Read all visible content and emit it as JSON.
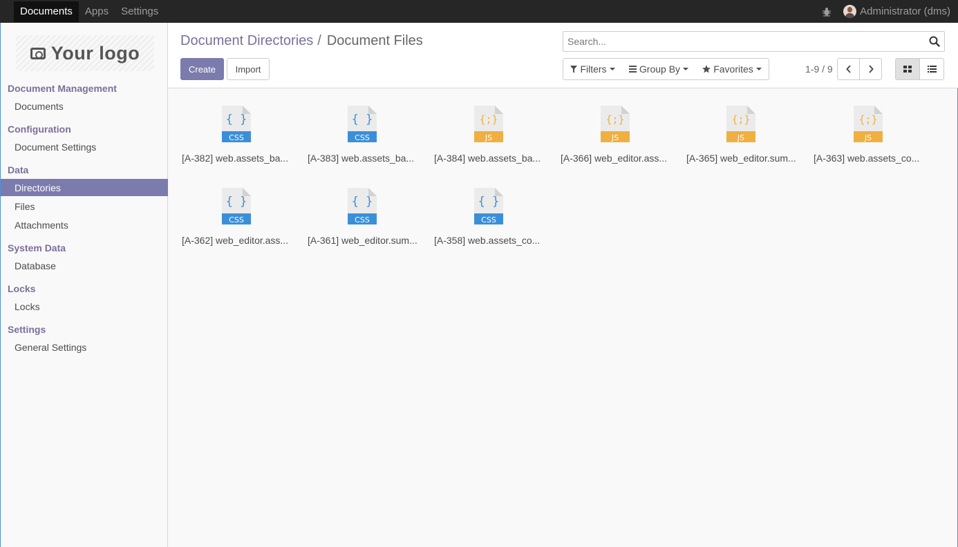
{
  "topbar": {
    "app_name": "Documents",
    "nav": [
      "Apps",
      "Settings"
    ],
    "user_name": "Administrator (dms)",
    "debug_icon": "bug-icon"
  },
  "sidebar": {
    "logo_text": "Your logo",
    "sections": [
      {
        "title": "Document Management",
        "items": [
          {
            "label": "Documents"
          }
        ]
      },
      {
        "title": "Configuration",
        "items": [
          {
            "label": "Document Settings"
          }
        ]
      },
      {
        "title": "Data",
        "items": [
          {
            "label": "Directories",
            "active": true
          },
          {
            "label": "Files"
          },
          {
            "label": "Attachments"
          }
        ]
      },
      {
        "title": "System Data",
        "items": [
          {
            "label": "Database"
          }
        ]
      },
      {
        "title": "Locks",
        "items": [
          {
            "label": "Locks"
          }
        ]
      },
      {
        "title": "Settings",
        "items": [
          {
            "label": "General Settings"
          }
        ]
      }
    ]
  },
  "control": {
    "breadcrumb_parent": "Document Directories",
    "breadcrumb_sep": "/",
    "breadcrumb_current": "Document Files",
    "create_label": "Create",
    "import_label": "Import",
    "search_placeholder": "Search...",
    "filters_label": "Filters",
    "groupby_label": "Group By",
    "favorites_label": "Favorites",
    "pager": "1-9 / 9",
    "active_view": "kanban"
  },
  "files": [
    {
      "label": "[A-382] web.assets_ba...",
      "type": "CSS"
    },
    {
      "label": "[A-383] web.assets_ba...",
      "type": "CSS"
    },
    {
      "label": "[A-384] web.assets_ba...",
      "type": "JS"
    },
    {
      "label": "[A-366] web_editor.ass...",
      "type": "JS"
    },
    {
      "label": "[A-365] web_editor.sum...",
      "type": "JS"
    },
    {
      "label": "[A-363] web.assets_co...",
      "type": "JS"
    },
    {
      "label": "[A-362] web_editor.ass...",
      "type": "CSS"
    },
    {
      "label": "[A-361] web_editor.sum...",
      "type": "CSS"
    },
    {
      "label": "[A-358] web.assets_co...",
      "type": "CSS"
    }
  ],
  "colors": {
    "accent": "#7c7bad",
    "css_icon": "#3b8fd9",
    "js_icon": "#efb041",
    "topbar": "#262626"
  }
}
